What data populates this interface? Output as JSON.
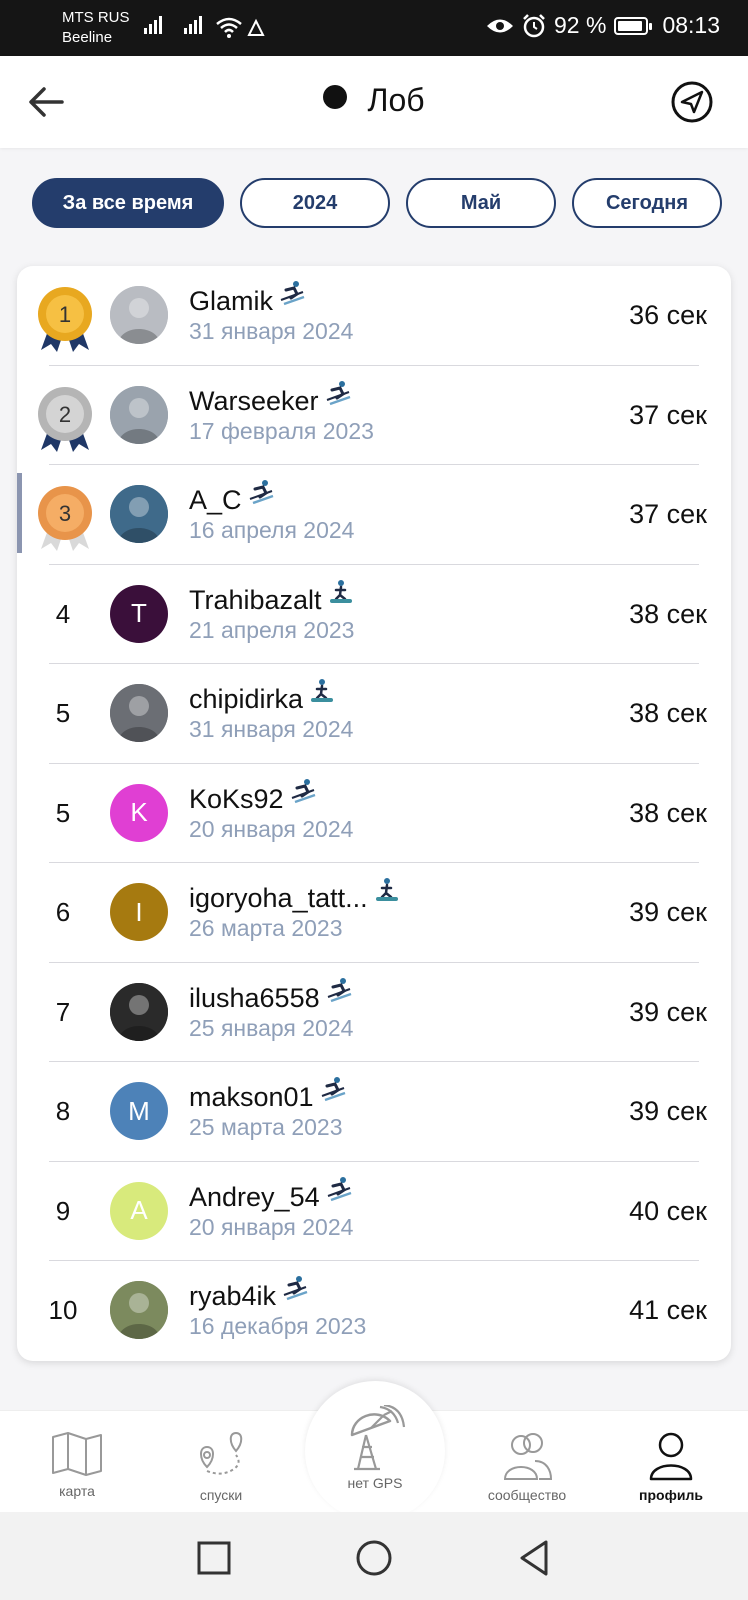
{
  "status_bar": {
    "carrier_1": "MTS RUS",
    "carrier_2": "Beeline",
    "battery": "92 %",
    "time": "08:13"
  },
  "header": {
    "title": "Лоб",
    "back_icon": "back-arrow-icon",
    "navigate_icon": "navigation-arrow-icon"
  },
  "filters": [
    {
      "label": "За все время",
      "active": true
    },
    {
      "label": "2024",
      "active": false
    },
    {
      "label": "Май",
      "active": false
    },
    {
      "label": "Сегодня",
      "active": false
    }
  ],
  "leaderboard": [
    {
      "rank": "1",
      "medal": "gold",
      "name": "Glamik",
      "sport": "ski",
      "date": "31 января 2024",
      "time": "36 сек",
      "avatar": {
        "type": "photo",
        "color": "#b9bcc2"
      }
    },
    {
      "rank": "2",
      "medal": "silver",
      "name": "Warseeker",
      "sport": "ski",
      "date": "17 февраля 2023",
      "time": "37 сек",
      "avatar": {
        "type": "photo",
        "color": "#9aa3ad"
      }
    },
    {
      "rank": "3",
      "medal": "bronze",
      "name": "A_C",
      "sport": "ski",
      "date": "16 апреля 2024",
      "time": "37 сек",
      "avatar": {
        "type": "photo",
        "color": "#3f6a8a"
      },
      "selected": true
    },
    {
      "rank": "4",
      "name": "Trahibazalt",
      "sport": "snowboard",
      "date": "21 апреля 2023",
      "time": "38 сек",
      "avatar": {
        "type": "letter",
        "letter": "T",
        "color": "#3a0f3a"
      }
    },
    {
      "rank": "5",
      "name": "chipidirka",
      "sport": "snowboard",
      "date": "31 января 2024",
      "time": "38 сек",
      "avatar": {
        "type": "photo",
        "color": "#6b6e74"
      }
    },
    {
      "rank": "5",
      "name": "KoKs92",
      "sport": "ski",
      "date": "20 января 2024",
      "time": "38 сек",
      "avatar": {
        "type": "letter",
        "letter": "K",
        "color": "#e03fd3"
      }
    },
    {
      "rank": "6",
      "name": "igoryoha_tatt...",
      "sport": "snowboard",
      "date": "26 марта 2023",
      "time": "39 сек",
      "avatar": {
        "type": "letter",
        "letter": "I",
        "color": "#a67a10"
      }
    },
    {
      "rank": "7",
      "name": "ilusha6558",
      "sport": "ski",
      "date": "25 января 2024",
      "time": "39 сек",
      "avatar": {
        "type": "photo",
        "color": "#2a2a2a"
      }
    },
    {
      "rank": "8",
      "name": "makson01",
      "sport": "ski",
      "date": "25 марта 2023",
      "time": "39 сек",
      "avatar": {
        "type": "letter",
        "letter": "M",
        "color": "#4d82b8"
      }
    },
    {
      "rank": "9",
      "name": "Andrey_54",
      "sport": "ski",
      "date": "20 января 2024",
      "time": "40 сек",
      "avatar": {
        "type": "letter",
        "letter": "A",
        "color": "#d8ea7c"
      }
    },
    {
      "rank": "10",
      "name": "ryab4ik",
      "sport": "ski",
      "date": "16 декабря 2023",
      "time": "41 сек",
      "avatar": {
        "type": "photo",
        "color": "#7c8a5e"
      }
    }
  ],
  "bottom_nav": [
    {
      "label": "карта",
      "icon": "map-icon"
    },
    {
      "label": "спуски",
      "icon": "route-icon"
    },
    {
      "label": "нет GPS",
      "icon": "satellite-dish-icon"
    },
    {
      "label": "сообщество",
      "icon": "community-icon"
    },
    {
      "label": "профиль",
      "icon": "profile-icon",
      "current": true
    }
  ],
  "colors": {
    "accent": "#243d6c",
    "date_text": "#8f9fb8",
    "gold": "#f4b43a",
    "silver": "#c9c9c9",
    "bronze": "#f2a45a"
  }
}
